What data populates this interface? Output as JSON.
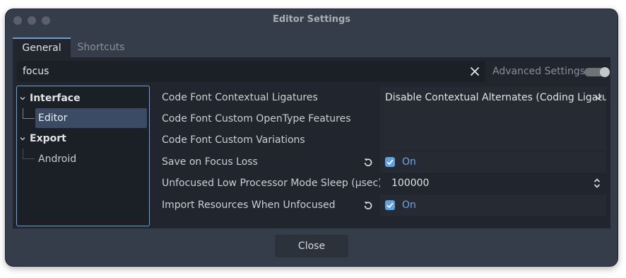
{
  "window": {
    "title": "Editor Settings"
  },
  "tabs": [
    {
      "label": "General",
      "active": true
    },
    {
      "label": "Shortcuts",
      "active": false
    }
  ],
  "search": {
    "value": "focus",
    "clear_icon": "close-icon"
  },
  "advanced": {
    "label": "Advanced Settings",
    "enabled": false
  },
  "tree": {
    "items": [
      {
        "label": "Interface",
        "bold": true,
        "expanded": true
      },
      {
        "label": "Editor",
        "bold": false,
        "selected": true
      },
      {
        "label": "Export",
        "bold": true,
        "expanded": true
      },
      {
        "label": "Android",
        "bold": false,
        "selected": false
      }
    ]
  },
  "properties": [
    {
      "name": "Code Font Contextual Ligatures",
      "value": "Disable Contextual Alternates (Coding Ligatures)",
      "type": "dropdown",
      "modified": false
    },
    {
      "name": "Code Font Custom OpenType Features",
      "value": "",
      "type": "text",
      "modified": false
    },
    {
      "name": "Code Font Custom Variations",
      "value": "",
      "type": "text",
      "modified": false
    },
    {
      "name": "Save on Focus Loss",
      "value": "On",
      "type": "checkbox",
      "checked": true,
      "modified": true
    },
    {
      "name": "Unfocused Low Processor Mode Sleep (µsec)",
      "value": "100000",
      "type": "spinbox",
      "modified": false
    },
    {
      "name": "Import Resources When Unfocused",
      "value": "On",
      "type": "checkbox",
      "checked": true,
      "modified": true
    }
  ],
  "footer": {
    "close_label": "Close"
  },
  "colors": {
    "accent": "#6ea1d4",
    "checkbox": "#5fa2e2",
    "window_bg": "#363d4a",
    "panel_bg": "#21262e"
  }
}
